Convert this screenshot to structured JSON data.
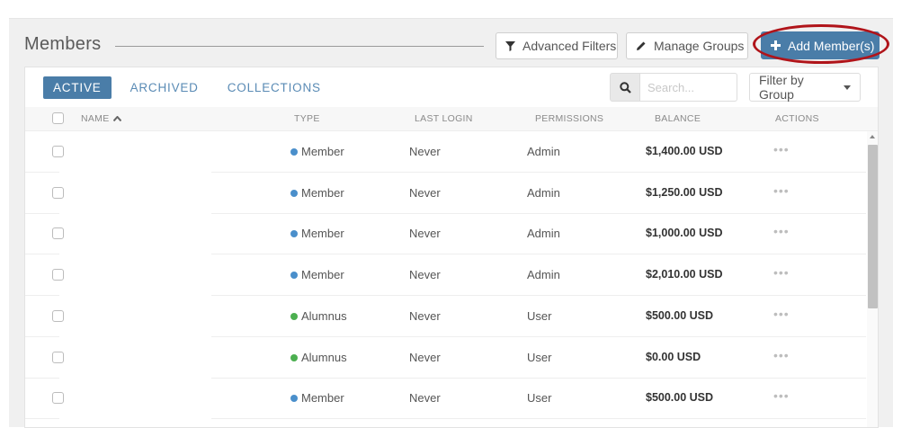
{
  "header": {
    "title": "Members",
    "advanced_filters_label": "Advanced Filters",
    "manage_groups_label": "Manage Groups",
    "add_member_label": "Add Member(s)"
  },
  "tabs": [
    {
      "label": "ACTIVE",
      "active": true
    },
    {
      "label": "ARCHIVED",
      "active": false
    },
    {
      "label": "COLLECTIONS",
      "active": false
    }
  ],
  "search": {
    "placeholder": "Search..."
  },
  "filter_group": {
    "label": "Filter by Group"
  },
  "table": {
    "columns": {
      "name": "NAME",
      "type": "TYPE",
      "last_login": "LAST LOGIN",
      "permissions": "PERMISSIONS",
      "balance": "BALANCE",
      "actions": "ACTIONS"
    },
    "rows": [
      {
        "type": "Member",
        "type_color": "#4a8fcb",
        "last_login": "Never",
        "permissions": "Admin",
        "balance": "$1,400.00 USD",
        "actions": "•••"
      },
      {
        "type": "Member",
        "type_color": "#4a8fcb",
        "last_login": "Never",
        "permissions": "Admin",
        "balance": "$1,250.00 USD",
        "actions": "•••"
      },
      {
        "type": "Member",
        "type_color": "#4a8fcb",
        "last_login": "Never",
        "permissions": "Admin",
        "balance": "$1,000.00 USD",
        "actions": "•••"
      },
      {
        "type": "Member",
        "type_color": "#4a8fcb",
        "last_login": "Never",
        "permissions": "Admin",
        "balance": "$2,010.00 USD",
        "actions": "•••"
      },
      {
        "type": "Alumnus",
        "type_color": "#4caf50",
        "last_login": "Never",
        "permissions": "User",
        "balance": "$500.00 USD",
        "actions": "•••"
      },
      {
        "type": "Alumnus",
        "type_color": "#4caf50",
        "last_login": "Never",
        "permissions": "User",
        "balance": "$0.00 USD",
        "actions": "•••"
      },
      {
        "type": "Member",
        "type_color": "#4a8fcb",
        "last_login": "Never",
        "permissions": "User",
        "balance": "$500.00 USD",
        "actions": "•••"
      }
    ]
  },
  "colors": {
    "accent": "#4a7da8",
    "highlight_ring": "#b0141a"
  }
}
